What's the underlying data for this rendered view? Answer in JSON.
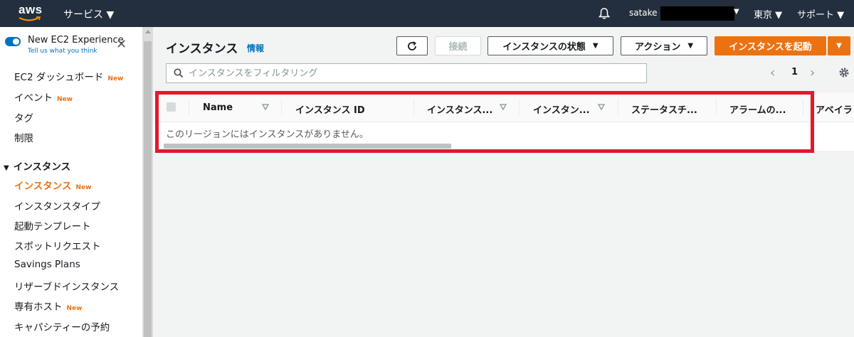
{
  "topbar": {
    "logo_text": "aws",
    "services_label": "サービス ▼",
    "user_label": "satake @",
    "region_label": "東京 ▼",
    "support_label": "サポート ▼"
  },
  "sidebar": {
    "experience_title": "New EC2 Experience",
    "experience_link": "Tell us what you think",
    "items": [
      {
        "label": "EC2 ダッシュボード",
        "badge": "New"
      },
      {
        "label": "イベント",
        "badge": "New"
      },
      {
        "label": "タグ",
        "badge": ""
      },
      {
        "label": "制限",
        "badge": ""
      }
    ],
    "section_label": "インスタンス",
    "section_items": [
      {
        "label": "インスタンス",
        "badge": "New"
      },
      {
        "label": "インスタンスタイプ",
        "badge": ""
      },
      {
        "label": "起動テンプレート",
        "badge": ""
      },
      {
        "label": "スポットリクエスト",
        "badge": ""
      },
      {
        "label": "Savings Plans",
        "badge": ""
      },
      {
        "label": "リザーブドインスタンス",
        "badge": ""
      },
      {
        "label": "専有ホスト",
        "badge": "New"
      },
      {
        "label": "キャパシティーの予約",
        "badge": ""
      }
    ]
  },
  "main": {
    "title": "インスタンス",
    "info_link": "情報",
    "buttons": {
      "connect": "接続",
      "instance_state": "インスタンスの状態",
      "actions": "アクション",
      "launch": "インスタンスを起動"
    },
    "search_placeholder": "インスタンスをフィルタリング",
    "page_number": "1",
    "table": {
      "columns": [
        "Name",
        "インスタンス ID",
        "インスタンス...",
        "インスタン...",
        "ステータスチ...",
        "アラームの...",
        "アベイラ"
      ],
      "empty_message": "このリージョンにはインスタンスがありません。"
    }
  }
}
